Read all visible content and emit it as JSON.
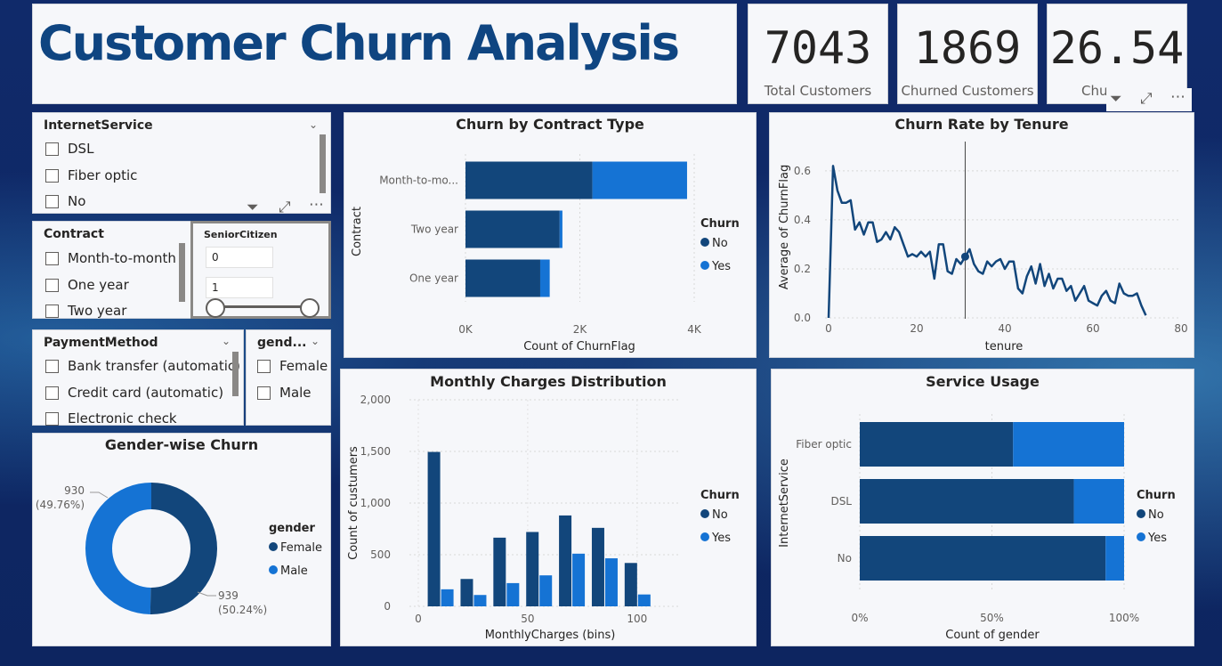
{
  "header": {
    "title": "Customer Churn Analysis"
  },
  "kpis": [
    {
      "value": "7043",
      "label": "Total Customers"
    },
    {
      "value": "1869",
      "label": "Churned Customers"
    },
    {
      "value": "26.54",
      "label": "Chu"
    }
  ],
  "slicers": {
    "internet": {
      "title": "InternetService",
      "options": [
        "DSL",
        "Fiber optic",
        "No"
      ]
    },
    "contract": {
      "title": "Contract",
      "options": [
        "Month-to-month",
        "One year",
        "Two year"
      ]
    },
    "senior": {
      "title": "SeniorCitizen",
      "values": [
        "0",
        "1"
      ]
    },
    "payment": {
      "title": "PaymentMethod",
      "options": [
        "Bank transfer (automatic)",
        "Credit card (automatic)",
        "Electronic check"
      ]
    },
    "gender": {
      "title": "gend...",
      "options": [
        "Female",
        "Male"
      ]
    }
  },
  "colors": {
    "no": "#12467b",
    "yes": "#1573d4",
    "line": "#12467b"
  },
  "icons": {
    "filter": "filter-icon",
    "focus": "focus-mode-icon",
    "more": "more-options-icon"
  },
  "chart_data": [
    {
      "type": "bar",
      "title": "Churn by Contract Type",
      "ylabel": "Contract",
      "xlabel": "Count of ChurnFlag",
      "categories": [
        "Month-to-mo...",
        "Two year",
        "One year"
      ],
      "series": [
        {
          "name": "No",
          "values": [
            2220,
            1647,
            1307
          ]
        },
        {
          "name": "Yes",
          "values": [
            1655,
            48,
            166
          ]
        }
      ],
      "xlim": [
        0,
        4000
      ],
      "xticks": [
        "0K",
        "2K",
        "4K"
      ],
      "legend": {
        "title": "Churn",
        "items": [
          "No",
          "Yes"
        ]
      }
    },
    {
      "type": "line",
      "title": "Churn Rate by Tenure",
      "xlabel": "tenure",
      "ylabel": "Average of ChurnFlag",
      "xlim": [
        0,
        80
      ],
      "ylim": [
        0,
        0.65
      ],
      "xticks": [
        "0",
        "20",
        "40",
        "60",
        "80"
      ],
      "yticks": [
        "0.0",
        "0.2",
        "0.4",
        "0.6"
      ],
      "x": [
        0,
        1,
        2,
        3,
        4,
        5,
        6,
        7,
        8,
        9,
        10,
        11,
        12,
        13,
        14,
        15,
        16,
        17,
        18,
        19,
        20,
        21,
        22,
        23,
        24,
        25,
        26,
        27,
        28,
        29,
        30,
        31,
        32,
        33,
        34,
        35,
        36,
        37,
        38,
        39,
        40,
        41,
        42,
        43,
        44,
        45,
        46,
        47,
        48,
        49,
        50,
        51,
        52,
        53,
        54,
        55,
        56,
        57,
        58,
        59,
        60,
        61,
        62,
        63,
        64,
        65,
        66,
        67,
        68,
        69,
        70,
        71,
        72
      ],
      "y": [
        0.0,
        0.62,
        0.52,
        0.47,
        0.47,
        0.48,
        0.36,
        0.39,
        0.34,
        0.39,
        0.39,
        0.31,
        0.32,
        0.35,
        0.32,
        0.37,
        0.35,
        0.3,
        0.25,
        0.26,
        0.25,
        0.27,
        0.25,
        0.27,
        0.16,
        0.3,
        0.3,
        0.19,
        0.18,
        0.24,
        0.22,
        0.25,
        0.28,
        0.22,
        0.19,
        0.18,
        0.23,
        0.21,
        0.23,
        0.24,
        0.2,
        0.23,
        0.23,
        0.12,
        0.1,
        0.17,
        0.21,
        0.14,
        0.22,
        0.13,
        0.18,
        0.12,
        0.16,
        0.16,
        0.11,
        0.13,
        0.07,
        0.1,
        0.13,
        0.07,
        0.06,
        0.05,
        0.09,
        0.11,
        0.07,
        0.06,
        0.14,
        0.1,
        0.09,
        0.09,
        0.1,
        0.05,
        0.01
      ],
      "highlight": {
        "x": 31,
        "y": 0.25
      }
    },
    {
      "type": "bar",
      "title": "Monthly Charges Distribution",
      "xlabel": "MonthlyCharges (bins)",
      "ylabel": "Count of custumers",
      "ylim": [
        0,
        2000
      ],
      "xlim": [
        0,
        120
      ],
      "yticks": [
        "0",
        "500",
        "1,000",
        "1,500",
        "2,000"
      ],
      "xticks": [
        "0",
        "50",
        "100"
      ],
      "x": [
        10,
        25,
        40,
        55,
        70,
        85,
        100
      ],
      "series": [
        {
          "name": "No",
          "values": [
            1495,
            265,
            665,
            720,
            880,
            760,
            420
          ]
        },
        {
          "name": "Yes",
          "values": [
            165,
            110,
            225,
            300,
            510,
            465,
            115
          ]
        }
      ],
      "legend": {
        "title": "Churn",
        "items": [
          "No",
          "Yes"
        ]
      }
    },
    {
      "type": "pie",
      "title": "Gender-wise Churn",
      "labels": [
        "Female",
        "Male"
      ],
      "values": [
        939,
        930
      ],
      "data_labels": [
        {
          "value": "939",
          "pct": "(50.24%)"
        },
        {
          "value": "930",
          "pct": "(49.76%)"
        }
      ],
      "legend": {
        "title": "gender",
        "items": [
          "Female",
          "Male"
        ]
      }
    },
    {
      "type": "bar",
      "title": "Service Usage",
      "ylabel": "InternetService",
      "xlabel": "Count of gender",
      "categories": [
        "Fiber optic",
        "DSL",
        "No"
      ],
      "series": [
        {
          "name": "No",
          "values": [
            58,
            81,
            93
          ]
        },
        {
          "name": "Yes",
          "values": [
            42,
            19,
            7
          ]
        }
      ],
      "xticks": [
        "0%",
        "50%",
        "100%"
      ],
      "legend": {
        "title": "Churn",
        "items": [
          "No",
          "Yes"
        ]
      }
    }
  ]
}
